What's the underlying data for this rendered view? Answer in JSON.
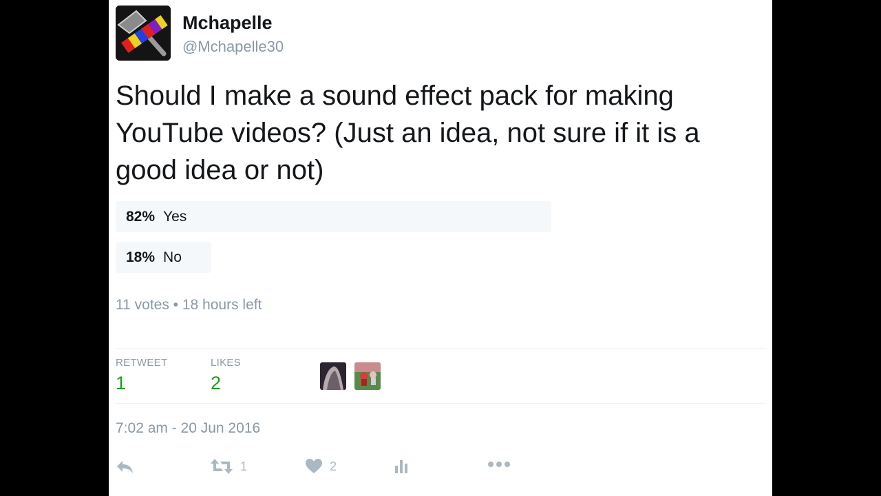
{
  "author": {
    "name": "Mchapelle",
    "handle": "@Mchapelle30"
  },
  "tweet": {
    "text": "Should I make a sound effect pack for making YouTube videos? (Just an idea, not sure if it is a good idea or not)"
  },
  "poll": {
    "choices": [
      {
        "percent": "82%",
        "label": "Yes",
        "share": 0.82
      },
      {
        "percent": "18%",
        "label": "No",
        "share": 0.18
      }
    ],
    "meta": "11 votes • 18 hours left"
  },
  "stats": {
    "retweet_label": "RETWEET",
    "retweet_count": "1",
    "likes_label": "LIKES",
    "likes_count": "2"
  },
  "timestamp": "7:02 am - 20 Jun 2016",
  "actions": {
    "reply_icon": "reply-icon",
    "retweet_icon": "retweet-icon",
    "retweet_count": "1",
    "like_icon": "heart-icon",
    "like_count": "2",
    "analytics_icon": "analytics-icon",
    "more_icon": "more-icon"
  },
  "colors": {
    "poll_bar": "#f5f8fa",
    "stat_value": "#19a019",
    "muted": "#8899a6"
  }
}
